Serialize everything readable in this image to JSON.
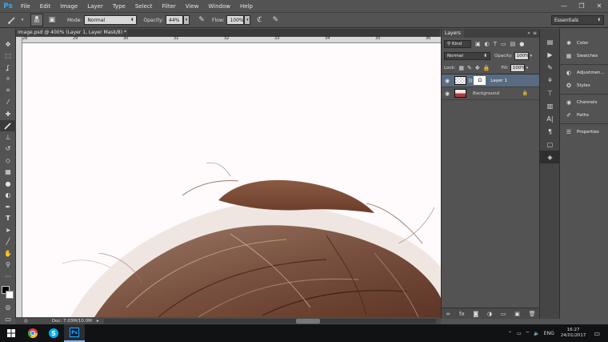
{
  "app": {
    "logo": "Ps",
    "menu": [
      "File",
      "Edit",
      "Image",
      "Layer",
      "Type",
      "Select",
      "Filter",
      "View",
      "Window",
      "Help"
    ],
    "window_controls": [
      "—",
      "❐",
      "✕"
    ]
  },
  "options_bar": {
    "brush_size": "80",
    "mode_label": "Mode:",
    "mode_value": "Normal",
    "opacity_label": "Opacity:",
    "opacity_value": "44%",
    "flow_label": "Flow:",
    "flow_value": "100%",
    "workspace": "Essentials"
  },
  "document": {
    "tab_title": "image.psd @ 400% (Layer 1, Layer Mask/8) *",
    "close_glyph": "×",
    "ruler_numbers": [
      "28",
      "29",
      "30",
      "31",
      "32",
      "33",
      "34",
      "35",
      "36"
    ],
    "status": "Doc: 7.03M/10.0M",
    "zoom_glyph": "◎"
  },
  "layers_panel": {
    "tab": "Layers",
    "kind_label": "Kind",
    "blend_mode": "Normal",
    "opacity_label": "Opacity:",
    "opacity_value": "100%",
    "lock_label": "Lock:",
    "fill_label": "Fill:",
    "fill_value": "100%",
    "layers": [
      {
        "name": "Layer 1",
        "active": true
      },
      {
        "name": "Background",
        "active": false
      }
    ],
    "footer_icons": [
      "∞",
      "fx",
      "◙",
      "◑",
      "▭",
      "▣",
      "🗑"
    ]
  },
  "right_panel": {
    "groups": [
      [
        "Color",
        "Swatches"
      ],
      [
        "Adjustmen...",
        "Styles"
      ],
      [
        "Channels",
        "Paths"
      ],
      [
        "Properties"
      ]
    ]
  },
  "taskbar": {
    "time": "16:27",
    "date": "24/01/2017",
    "language": "ENG"
  },
  "colors": {
    "ps_blue": "#31a8ff",
    "canvas_bg": "#fffafb",
    "panel_bg": "#535353",
    "active_layer": "#586b80",
    "hair_brown": "#7a4a34"
  }
}
